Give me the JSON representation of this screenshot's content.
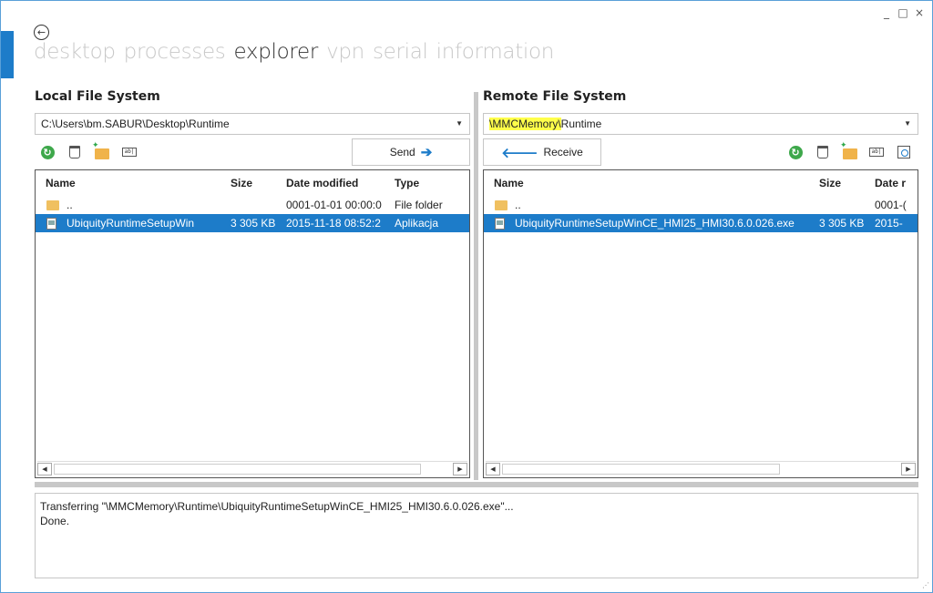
{
  "window": {
    "controls": {
      "minimize": "_",
      "maximize": "□",
      "close": "×"
    },
    "back_glyph": "←"
  },
  "nav": {
    "items": [
      "desktop",
      "processes",
      "explorer",
      "vpn",
      "serial",
      "information"
    ],
    "active": "explorer"
  },
  "local": {
    "title": "Local File System",
    "path": "C:\\Users\\bm.SABUR\\Desktop\\Runtime",
    "send_label": "Send",
    "columns": [
      "Name",
      "Size",
      "Date modified",
      "Type"
    ],
    "rows": [
      {
        "name": "..",
        "size": "",
        "date": "0001-01-01 00:00:0",
        "type": "File folder",
        "kind": "folder"
      },
      {
        "name": "UbiquityRuntimeSetupWin",
        "size": "3 305 KB",
        "date": "2015-11-18 08:52:2",
        "type": "Aplikacja",
        "kind": "file",
        "selected": true
      }
    ]
  },
  "remote": {
    "title": "Remote File System",
    "path_highlight": "\\MMCMemory\\",
    "path_rest": "Runtime",
    "receive_label": "Receive",
    "columns": [
      "Name",
      "Size",
      "Date r"
    ],
    "rows": [
      {
        "name": "..",
        "size": "",
        "date": "0001-(",
        "kind": "folder"
      },
      {
        "name": "UbiquityRuntimeSetupWinCE_HMI25_HMI30.6.0.026.exe",
        "size": "3 305 KB",
        "date": "2015-",
        "kind": "file",
        "selected": true
      }
    ]
  },
  "log": {
    "lines": [
      "Transferring \"\\MMCMemory\\Runtime\\UbiquityRuntimeSetupWinCE_HMI25_HMI30.6.0.026.exe\"...",
      "Done."
    ]
  },
  "colors": {
    "accent": "#1d7cc9",
    "highlight": "#ffff4a",
    "refresh": "#3ea84b"
  },
  "icons": {
    "toolbar": [
      "refresh-icon",
      "delete-icon",
      "new-folder-icon",
      "rename-icon",
      "properties-icon"
    ]
  }
}
